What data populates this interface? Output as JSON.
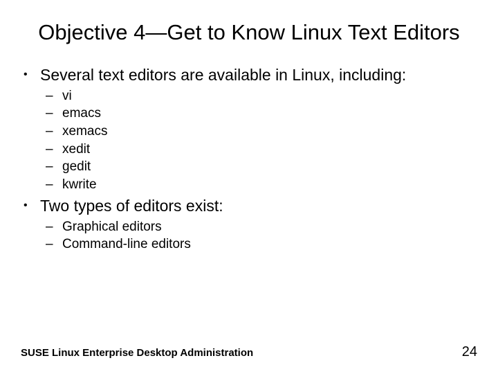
{
  "title": "Objective 4—Get to Know Linux Text Editors",
  "bullets": [
    {
      "text": "Several text editors are available in Linux, including:",
      "sub": [
        "vi",
        "emacs",
        "xemacs",
        "xedit",
        "gedit",
        "kwrite"
      ]
    },
    {
      "text": "Two types of editors exist:",
      "sub": [
        "Graphical editors",
        "Command-line editors"
      ]
    }
  ],
  "footer": {
    "left": "SUSE Linux Enterprise Desktop Administration",
    "right": "24"
  }
}
